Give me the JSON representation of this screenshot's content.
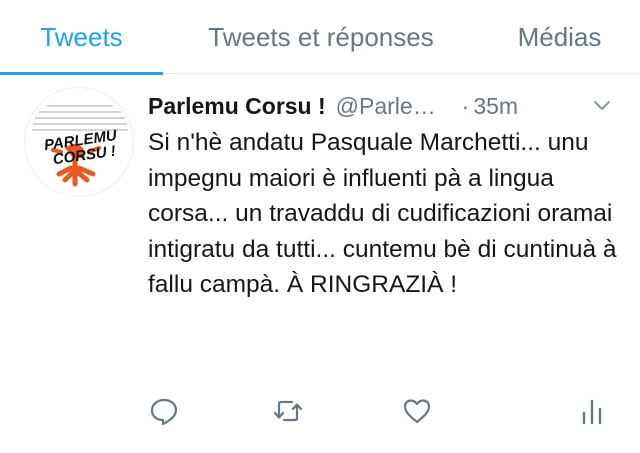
{
  "tabs": [
    {
      "label": "Tweets",
      "active": true
    },
    {
      "label": "Tweets et réponses",
      "active": false
    },
    {
      "label": "Médias",
      "active": false
    }
  ],
  "tweet": {
    "author_name": "Parlemu Corsu !",
    "handle": "@ParlemuCorsu",
    "separator": "·",
    "time": "35m",
    "text": "Si n'hè andatu Pasquale Marchetti... unu impegnu maiori è influenti pà a lingua corsa... un travaddu di cudificazioni oramai intigratu da tutti... cuntemu bè di cuntinuà à fallu campà. À RINGRAZIÀ !",
    "avatar_logo_text": [
      "PARLEMU",
      "CORSU !"
    ]
  },
  "icons": {
    "caret": "chevron-down-icon",
    "reply": "reply-icon",
    "retweet": "retweet-icon",
    "like": "heart-icon",
    "stats": "analytics-icon"
  },
  "colors": {
    "accent": "#1da1f2",
    "muted": "#657786",
    "text": "#14171a",
    "logo_orange": "#e8591d"
  }
}
